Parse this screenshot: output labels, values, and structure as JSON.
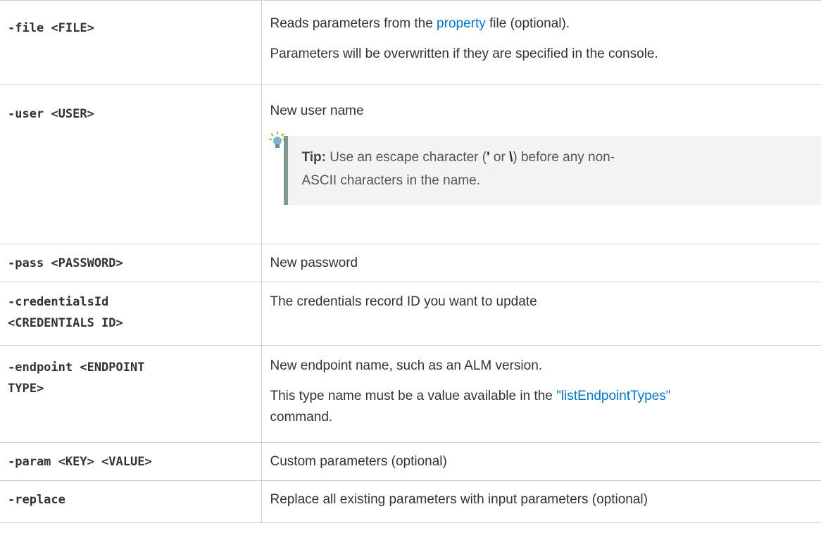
{
  "rows": [
    {
      "param": "-file <FILE>",
      "desc_pre": "Reads parameters from the ",
      "desc_link": "property",
      "desc_post": " file (optional).",
      "desc_line2": "Parameters will be overwritten if they are specified in the console."
    },
    {
      "param": "-user <USER>",
      "desc": "New user name",
      "tip": {
        "label": "Tip:",
        "text_pre": " Use an escape character (",
        "esc1": "'",
        "text_mid": " or ",
        "esc2": "\\",
        "text_post": ") before any non-",
        "line2": "ASCII characters in the name."
      }
    },
    {
      "param": "-pass <PASSWORD>",
      "desc": "New password"
    },
    {
      "param_line1": "-credentialsId",
      "param_line2": "<CREDENTIALS ID>",
      "desc": "The credentials record ID you want to update"
    },
    {
      "param_line1": "-endpoint <ENDPOINT",
      "param_line2": "TYPE>",
      "desc": "New endpoint name, such as an ALM version.",
      "desc2_pre": "This type name must be a value available in the ",
      "desc2_link": "\"listEndpointTypes\"",
      "desc2_post": "command."
    },
    {
      "param": "-param <KEY> <VALUE>",
      "desc": "Custom parameters (optional)"
    },
    {
      "param": "-replace",
      "desc": "Replace all existing parameters with input parameters (optional)"
    }
  ],
  "colors": {
    "link": "#0073c6",
    "tip_border": "#7c9a8e",
    "tip_bg": "#f3f3f3"
  },
  "icons": {
    "tip": "lightbulb-icon"
  }
}
